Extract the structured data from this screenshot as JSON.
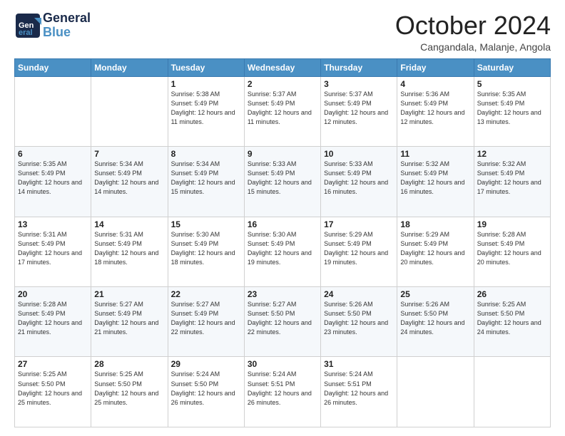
{
  "header": {
    "logo_general": "General",
    "logo_blue": "Blue",
    "month_title": "October 2024",
    "location": "Cangandala, Malanje, Angola"
  },
  "weekdays": [
    "Sunday",
    "Monday",
    "Tuesday",
    "Wednesday",
    "Thursday",
    "Friday",
    "Saturday"
  ],
  "weeks": [
    [
      {
        "day": "",
        "sunrise": "",
        "sunset": "",
        "daylight": ""
      },
      {
        "day": "",
        "sunrise": "",
        "sunset": "",
        "daylight": ""
      },
      {
        "day": "1",
        "sunrise": "Sunrise: 5:38 AM",
        "sunset": "Sunset: 5:49 PM",
        "daylight": "Daylight: 12 hours and 11 minutes."
      },
      {
        "day": "2",
        "sunrise": "Sunrise: 5:37 AM",
        "sunset": "Sunset: 5:49 PM",
        "daylight": "Daylight: 12 hours and 11 minutes."
      },
      {
        "day": "3",
        "sunrise": "Sunrise: 5:37 AM",
        "sunset": "Sunset: 5:49 PM",
        "daylight": "Daylight: 12 hours and 12 minutes."
      },
      {
        "day": "4",
        "sunrise": "Sunrise: 5:36 AM",
        "sunset": "Sunset: 5:49 PM",
        "daylight": "Daylight: 12 hours and 12 minutes."
      },
      {
        "day": "5",
        "sunrise": "Sunrise: 5:35 AM",
        "sunset": "Sunset: 5:49 PM",
        "daylight": "Daylight: 12 hours and 13 minutes."
      }
    ],
    [
      {
        "day": "6",
        "sunrise": "Sunrise: 5:35 AM",
        "sunset": "Sunset: 5:49 PM",
        "daylight": "Daylight: 12 hours and 14 minutes."
      },
      {
        "day": "7",
        "sunrise": "Sunrise: 5:34 AM",
        "sunset": "Sunset: 5:49 PM",
        "daylight": "Daylight: 12 hours and 14 minutes."
      },
      {
        "day": "8",
        "sunrise": "Sunrise: 5:34 AM",
        "sunset": "Sunset: 5:49 PM",
        "daylight": "Daylight: 12 hours and 15 minutes."
      },
      {
        "day": "9",
        "sunrise": "Sunrise: 5:33 AM",
        "sunset": "Sunset: 5:49 PM",
        "daylight": "Daylight: 12 hours and 15 minutes."
      },
      {
        "day": "10",
        "sunrise": "Sunrise: 5:33 AM",
        "sunset": "Sunset: 5:49 PM",
        "daylight": "Daylight: 12 hours and 16 minutes."
      },
      {
        "day": "11",
        "sunrise": "Sunrise: 5:32 AM",
        "sunset": "Sunset: 5:49 PM",
        "daylight": "Daylight: 12 hours and 16 minutes."
      },
      {
        "day": "12",
        "sunrise": "Sunrise: 5:32 AM",
        "sunset": "Sunset: 5:49 PM",
        "daylight": "Daylight: 12 hours and 17 minutes."
      }
    ],
    [
      {
        "day": "13",
        "sunrise": "Sunrise: 5:31 AM",
        "sunset": "Sunset: 5:49 PM",
        "daylight": "Daylight: 12 hours and 17 minutes."
      },
      {
        "day": "14",
        "sunrise": "Sunrise: 5:31 AM",
        "sunset": "Sunset: 5:49 PM",
        "daylight": "Daylight: 12 hours and 18 minutes."
      },
      {
        "day": "15",
        "sunrise": "Sunrise: 5:30 AM",
        "sunset": "Sunset: 5:49 PM",
        "daylight": "Daylight: 12 hours and 18 minutes."
      },
      {
        "day": "16",
        "sunrise": "Sunrise: 5:30 AM",
        "sunset": "Sunset: 5:49 PM",
        "daylight": "Daylight: 12 hours and 19 minutes."
      },
      {
        "day": "17",
        "sunrise": "Sunrise: 5:29 AM",
        "sunset": "Sunset: 5:49 PM",
        "daylight": "Daylight: 12 hours and 19 minutes."
      },
      {
        "day": "18",
        "sunrise": "Sunrise: 5:29 AM",
        "sunset": "Sunset: 5:49 PM",
        "daylight": "Daylight: 12 hours and 20 minutes."
      },
      {
        "day": "19",
        "sunrise": "Sunrise: 5:28 AM",
        "sunset": "Sunset: 5:49 PM",
        "daylight": "Daylight: 12 hours and 20 minutes."
      }
    ],
    [
      {
        "day": "20",
        "sunrise": "Sunrise: 5:28 AM",
        "sunset": "Sunset: 5:49 PM",
        "daylight": "Daylight: 12 hours and 21 minutes."
      },
      {
        "day": "21",
        "sunrise": "Sunrise: 5:27 AM",
        "sunset": "Sunset: 5:49 PM",
        "daylight": "Daylight: 12 hours and 21 minutes."
      },
      {
        "day": "22",
        "sunrise": "Sunrise: 5:27 AM",
        "sunset": "Sunset: 5:49 PM",
        "daylight": "Daylight: 12 hours and 22 minutes."
      },
      {
        "day": "23",
        "sunrise": "Sunrise: 5:27 AM",
        "sunset": "Sunset: 5:50 PM",
        "daylight": "Daylight: 12 hours and 22 minutes."
      },
      {
        "day": "24",
        "sunrise": "Sunrise: 5:26 AM",
        "sunset": "Sunset: 5:50 PM",
        "daylight": "Daylight: 12 hours and 23 minutes."
      },
      {
        "day": "25",
        "sunrise": "Sunrise: 5:26 AM",
        "sunset": "Sunset: 5:50 PM",
        "daylight": "Daylight: 12 hours and 24 minutes."
      },
      {
        "day": "26",
        "sunrise": "Sunrise: 5:25 AM",
        "sunset": "Sunset: 5:50 PM",
        "daylight": "Daylight: 12 hours and 24 minutes."
      }
    ],
    [
      {
        "day": "27",
        "sunrise": "Sunrise: 5:25 AM",
        "sunset": "Sunset: 5:50 PM",
        "daylight": "Daylight: 12 hours and 25 minutes."
      },
      {
        "day": "28",
        "sunrise": "Sunrise: 5:25 AM",
        "sunset": "Sunset: 5:50 PM",
        "daylight": "Daylight: 12 hours and 25 minutes."
      },
      {
        "day": "29",
        "sunrise": "Sunrise: 5:24 AM",
        "sunset": "Sunset: 5:50 PM",
        "daylight": "Daylight: 12 hours and 26 minutes."
      },
      {
        "day": "30",
        "sunrise": "Sunrise: 5:24 AM",
        "sunset": "Sunset: 5:51 PM",
        "daylight": "Daylight: 12 hours and 26 minutes."
      },
      {
        "day": "31",
        "sunrise": "Sunrise: 5:24 AM",
        "sunset": "Sunset: 5:51 PM",
        "daylight": "Daylight: 12 hours and 26 minutes."
      },
      {
        "day": "",
        "sunrise": "",
        "sunset": "",
        "daylight": ""
      },
      {
        "day": "",
        "sunrise": "",
        "sunset": "",
        "daylight": ""
      }
    ]
  ]
}
